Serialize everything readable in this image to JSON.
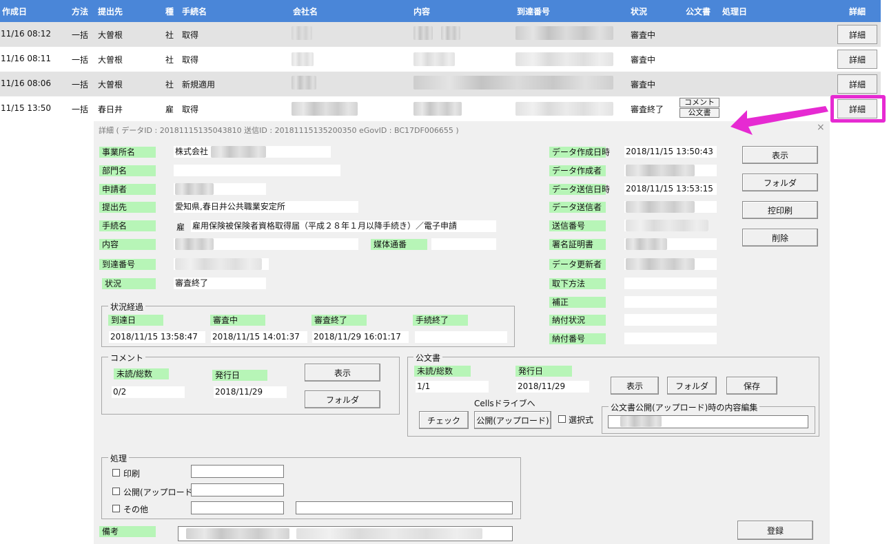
{
  "header": {
    "col_date": "作成日",
    "col_method": "方法",
    "col_submit_to": "提出先",
    "col_type": "種",
    "col_procedure": "手続名",
    "col_company": "会社名",
    "col_content": "内容",
    "col_arrival": "到達番号",
    "col_status": "状況",
    "col_official": "公文書",
    "col_processed": "処理日",
    "col_detail": "詳細"
  },
  "rows": [
    {
      "date": "11/16 08:12",
      "method": "一括",
      "submit_to": "大曽根",
      "type": "社",
      "procedure": "取得",
      "status": "審査中",
      "detail": "詳細"
    },
    {
      "date": "11/16 08:11",
      "method": "一括",
      "submit_to": "大曽根",
      "type": "社",
      "procedure": "取得",
      "status": "審査中",
      "detail": "詳細"
    },
    {
      "date": "11/16 08:06",
      "method": "一括",
      "submit_to": "大曽根",
      "type": "社",
      "procedure": "新規適用",
      "status": "審査中",
      "detail": "詳細"
    },
    {
      "date": "11/15 13:50",
      "method": "一括",
      "submit_to": "春日井",
      "type": "雇",
      "procedure": "取得",
      "status": "審査終了",
      "detail": "詳細",
      "comment_btn": "コメント",
      "official_btn": "公文書"
    }
  ],
  "dialog": {
    "title": "詳細 ( データID : 20181115135043810 送信ID : 20181115135200350 eGovID : BC17DF006655 )",
    "close": "×",
    "left": {
      "office_name_label": "事業所名",
      "office_name_value": "株式会社",
      "dept_label": "部門名",
      "applicant_label": "申請者",
      "submit_to_label": "提出先",
      "submit_to_value": "愛知県,春日井公共職業安定所",
      "procedure_label": "手続名",
      "procedure_type": "雇",
      "procedure_value": "雇用保険被保険者資格取得届（平成２８年１月以降手続き）／電子申請",
      "content_label": "内容",
      "media_label": "媒体通番",
      "arrival_label": "到達番号",
      "status_label": "状況",
      "status_value": "審査終了"
    },
    "right": {
      "created_at_label": "データ作成日時",
      "created_at_value": "2018/11/15 13:50:43",
      "creator_label": "データ作成者",
      "sent_at_label": "データ送信日時",
      "sent_at_value": "2018/11/15 13:53:15",
      "sender_label": "データ送信者",
      "send_no_label": "送信番号",
      "cert_label": "署名証明書",
      "updater_label": "データ更新者",
      "withdraw_label": "取下方法",
      "correction_label": "補正",
      "payment_status_label": "納付状況",
      "payment_no_label": "納付番号"
    },
    "buttons": {
      "show": "表示",
      "folder": "フォルダ",
      "copy_print": "控印刷",
      "delete": "削除",
      "register": "登録"
    },
    "progress": {
      "title": "状況経過",
      "arrival_label": "到達日",
      "arrival_value": "2018/11/15 13:58:47",
      "reviewing_label": "審査中",
      "reviewing_value": "2018/11/15 14:01:37",
      "reviewed_label": "審査終了",
      "reviewed_value": "2018/11/29 16:01:17",
      "finished_label": "手続終了",
      "finished_value": ""
    },
    "comment": {
      "title": "コメント",
      "unread_label": "未読/総数",
      "unread_value": "0/2",
      "issued_label": "発行日",
      "issued_value": "2018/11/29",
      "show_btn": "表示",
      "folder_btn": "フォルダ"
    },
    "official": {
      "title": "公文書",
      "unread_label": "未読/総数",
      "unread_value": "1/1",
      "issued_label": "発行日",
      "issued_value": "2018/11/29",
      "show_btn": "表示",
      "folder_btn": "フォルダ",
      "save_btn": "保存",
      "cells_label": "Cellsドライブへ",
      "check_btn": "チェック",
      "publish_btn": "公開(アップロード)",
      "select_label": "選択式",
      "edit_group_title": "公文書公開(アップロード)時の内容編集"
    },
    "processing": {
      "title": "処理",
      "print_label": "印刷",
      "publish_label": "公開(アップロード)",
      "other_label": "その他"
    },
    "remarks_label": "備考"
  },
  "colors": {
    "header_bg": "#4a86d8",
    "label_bg": "#b7f5b7",
    "highlight": "#e62ad2",
    "dialog_bg": "#f0f0f0"
  }
}
